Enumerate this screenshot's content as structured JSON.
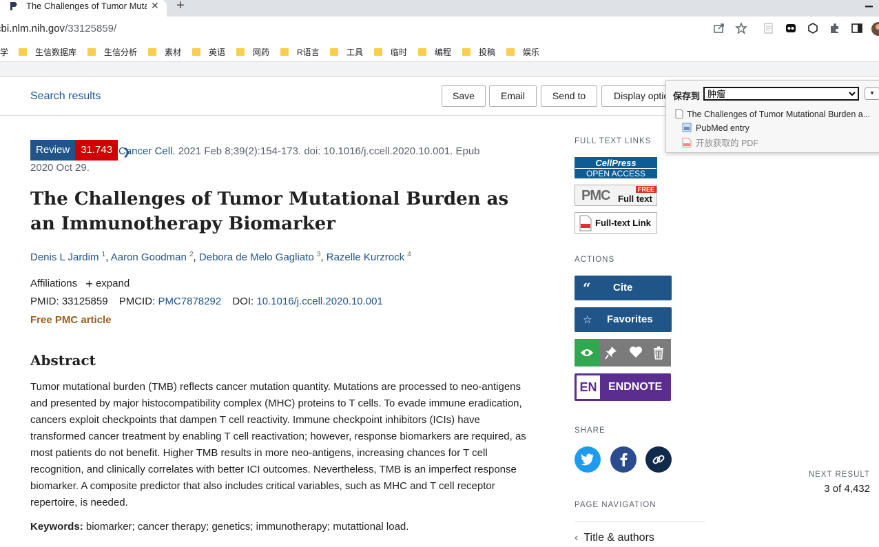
{
  "browser": {
    "tab_title": "The Challenges of Tumor Mutational Burden as an Immunotherapy Biomarker",
    "url_host": "cbi.nlm.nih.gov",
    "url_path": "/33125859/",
    "bookmarks": [
      "学",
      "生信数据库",
      "生信分析",
      "素材",
      "英语",
      "网药",
      "R语言",
      "工具",
      "临时",
      "编程",
      "投稿",
      "娱乐"
    ]
  },
  "page": {
    "search_results": "Search results",
    "buttons": {
      "save": "Save",
      "email": "Email",
      "send_to": "Send to",
      "display_options": "Display options"
    }
  },
  "article": {
    "badge_review": "Review",
    "badge_if": "31.743",
    "journal": "Cancer Cell.",
    "citation_rest": " 2021 Feb 8;39(2):154-173. doi: 10.1016/j.ccell.2020.10.001. Epub 2020 Oct 29.",
    "title": "The Challenges of Tumor Mutational Burden as an Immunotherapy Biomarker",
    "authors": [
      {
        "name": "Denis L Jardim",
        "sup": "1"
      },
      {
        "name": "Aaron Goodman",
        "sup": "2"
      },
      {
        "name": "Debora de Melo Gagliato",
        "sup": "3"
      },
      {
        "name": "Razelle Kurzrock",
        "sup": "4"
      }
    ],
    "affiliations_label": "Affiliations",
    "expand_label": "expand",
    "pmid_label": "PMID:",
    "pmid": "33125859",
    "pmcid_label": "PMCID:",
    "pmcid": "PMC7878292",
    "doi_label": "DOI:",
    "doi": "10.1016/j.ccell.2020.10.001",
    "free_pmc": "Free PMC article",
    "abstract_title": "Abstract",
    "abstract": "Tumor mutational burden (TMB) reflects cancer mutation quantity. Mutations are processed to neo-antigens and presented by major histocompatibility complex (MHC) proteins to T cells. To evade immune eradication, cancers exploit checkpoints that dampen T cell reactivity. Immune checkpoint inhibitors (ICIs) have transformed cancer treatment by enabling T cell reactivation; however, response biomarkers are required, as most patients do not benefit. Higher TMB results in more neo-antigens, increasing chances for T cell recognition, and clinically correlates with better ICI outcomes. Nevertheless, TMB is an imperfect response biomarker. A composite predictor that also includes critical variables, such as MHC and T cell receptor repertoire, is needed.",
    "keywords_label": "Keywords:",
    "keywords": "biomarker; cancer therapy; genetics; immunotherapy; mutattional load."
  },
  "sidebar": {
    "full_text_links": "FULL TEXT LINKS",
    "cellpress_top": "CellPress",
    "cellpress_bottom": "OPEN ACCESS",
    "pmc_free": "FREE",
    "pmc_label": "PMC",
    "pmc_full_text": "Full text",
    "full_text_link": "Full-text Link",
    "actions": "ACTIONS",
    "cite": "Cite",
    "favorites": "Favorites",
    "endnote_en": "EN",
    "endnote": "ENDNOTE",
    "share": "SHARE",
    "page_navigation": "PAGE NAVIGATION",
    "title_authors": "Title & authors",
    "next_result_label": "NEXT RESULT",
    "next_result_value": "3 of 4,432"
  },
  "save_popup": {
    "label": "保存到",
    "folder": "肿瘤",
    "item_title": "The Challenges of Tumor Mutational Burden a...",
    "pubmed_entry": "PubMed entry",
    "open_pdf": "开放获取的 PDF"
  },
  "colors": {
    "link": "#20558a",
    "review_badge": "#20558a",
    "impact_factor": "#d00000",
    "free_pmc": "#9a5b1b",
    "endnote": "#5b2d8e",
    "twitter": "#1d9bf0",
    "facebook": "#2a4b8d",
    "link_share": "#0f2a4a",
    "eye": "#2fa84f"
  }
}
